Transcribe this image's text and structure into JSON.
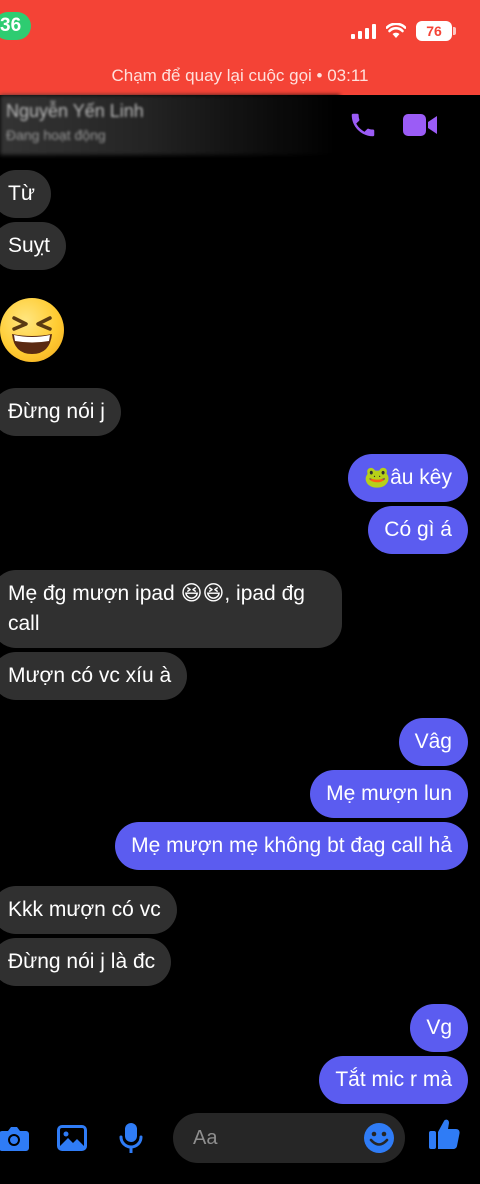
{
  "status": {
    "time": "36",
    "battery": "76"
  },
  "call_banner": {
    "text": "Chạm để quay lại cuộc gọi • 03:11"
  },
  "header": {
    "name": "Nguyễn Yến Linh",
    "subtitle": "Đang hoạt động",
    "icons": [
      "phone-icon",
      "video-icon"
    ]
  },
  "messages": [
    {
      "dir": "in",
      "text": "Từ"
    },
    {
      "dir": "in",
      "text": "Suỵt"
    },
    {
      "dir": "in",
      "emoji": "grinning-squinting-face"
    },
    {
      "dir": "in",
      "text": "Đừng nói j"
    },
    {
      "dir": "out",
      "text": "🐸âu kêy"
    },
    {
      "dir": "out",
      "text": "Có gì á"
    },
    {
      "dir": "in",
      "text": "Mẹ đg mượn  ipad 😆😆, ipad đg call"
    },
    {
      "dir": "in",
      "text": "Mượn có vc xíu à"
    },
    {
      "dir": "out",
      "text": "Vâg"
    },
    {
      "dir": "out",
      "text": "Mẹ mượn lun"
    },
    {
      "dir": "out",
      "text": "Mẹ mượn mẹ không bt đag call hả"
    },
    {
      "dir": "in",
      "text": "Kkk mượn có vc"
    },
    {
      "dir": "in",
      "text": "Đừng nói j là đc"
    },
    {
      "dir": "out",
      "text": "Vg"
    },
    {
      "dir": "out",
      "text": "Tắt mic r mà"
    }
  ],
  "composer": {
    "placeholder": "Aa",
    "icons": [
      "camera-icon",
      "image-icon",
      "mic-icon",
      "emoji-icon",
      "thumbs-up-icon"
    ]
  },
  "colors": {
    "call_banner": "#f44336",
    "outgoing": "#5b5cf0",
    "incoming": "#303030",
    "accent": "#9b5cf6",
    "composer_icon": "#2f7cf6"
  }
}
